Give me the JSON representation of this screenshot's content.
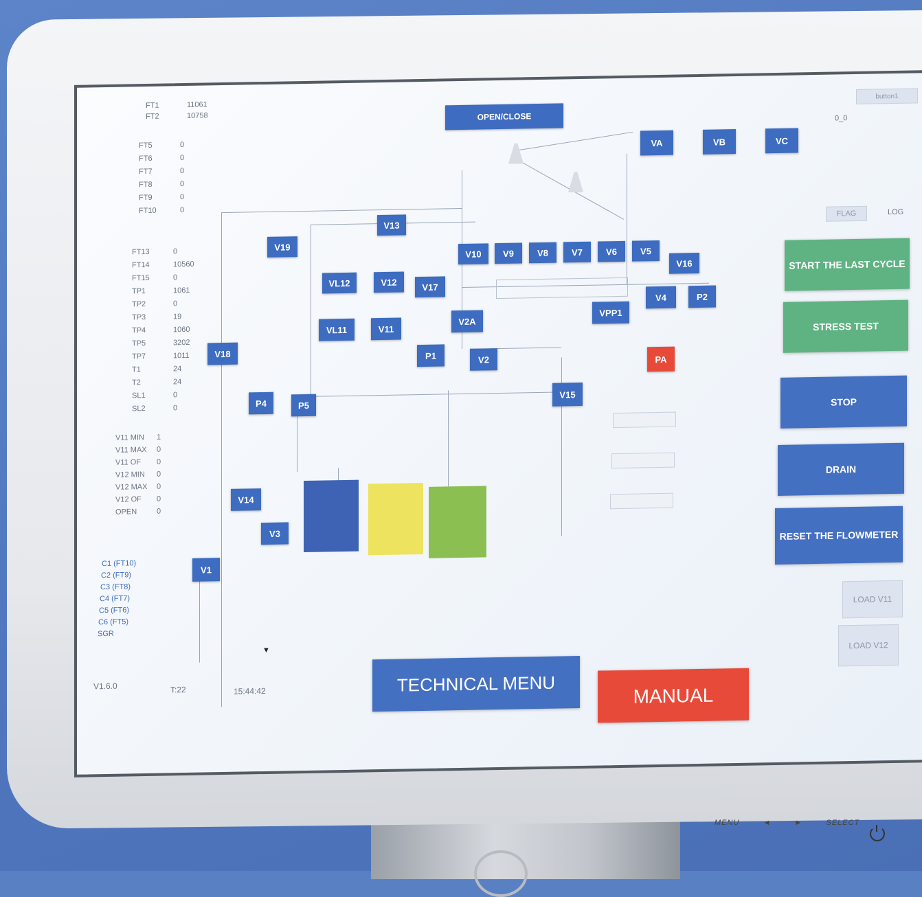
{
  "top_button": "OPEN/CLOSE",
  "top_right": "button1",
  "sensors_top": [
    [
      "FT1",
      "11061"
    ],
    [
      "FT2",
      "10758"
    ]
  ],
  "sensors_mid": [
    [
      "FT5",
      "0"
    ],
    [
      "FT6",
      "0"
    ],
    [
      "FT7",
      "0"
    ],
    [
      "FT8",
      "0"
    ],
    [
      "FT9",
      "0"
    ],
    [
      "FT10",
      "0"
    ]
  ],
  "sensors_list": [
    [
      "FT13",
      "0"
    ],
    [
      "FT14",
      "10560"
    ],
    [
      "FT15",
      "0"
    ],
    [
      "TP1",
      "1061"
    ],
    [
      "TP2",
      "0"
    ],
    [
      "TP3",
      "19"
    ],
    [
      "TP4",
      "1060"
    ],
    [
      "TP5",
      "3202"
    ],
    [
      "TP7",
      "1011"
    ],
    [
      "T1",
      "24"
    ],
    [
      "T2",
      "24"
    ],
    [
      "SL1",
      "0"
    ],
    [
      "SL2",
      "0"
    ]
  ],
  "limits": [
    [
      "V11 MIN",
      "1"
    ],
    [
      "V11 MAX",
      "0"
    ],
    [
      "V11 OF",
      "0"
    ],
    [
      "V12 MIN",
      "0"
    ],
    [
      "V12 MAX",
      "0"
    ],
    [
      "V12 OF",
      "0"
    ],
    [
      "OPEN",
      "0"
    ]
  ],
  "counters": [
    "C1 (FT10)",
    "C2 (FT9)",
    "C3 (FT8)",
    "C4 (FT7)",
    "C5 (FT6)",
    "C6 (FT5)",
    "SGR"
  ],
  "status": {
    "version": "V1.6.0",
    "temp": "T:22",
    "time": "15:44:42"
  },
  "right_labels": {
    "r1": "0_0",
    "flag": "FLAG",
    "log": "LOG"
  },
  "valves": {
    "VA": "VA",
    "VB": "VB",
    "VC": "VC",
    "V13": "V13",
    "V19": "V19",
    "V10": "V10",
    "V9": "V9",
    "V8": "V8",
    "V7": "V7",
    "V6": "V6",
    "V5": "V5",
    "V16": "V16",
    "VL12": "VL12",
    "V12": "V12",
    "V17": "V17",
    "V4": "V4",
    "P2": "P2",
    "VL11": "VL11",
    "V11": "V11",
    "V2A": "V2A",
    "VPP1": "VPP1",
    "V18": "V18",
    "P1": "P1",
    "V2": "V2",
    "PA": "PA",
    "V15": "V15",
    "P4": "P4",
    "P5": "P5",
    "V14": "V14",
    "V3": "V3",
    "V1": "V1"
  },
  "actions": {
    "start_last_cycle": "START THE LAST CYCLE",
    "stress_test": "STRESS TEST",
    "stop": "STOP",
    "drain": "DRAIN",
    "reset_flowmeter": "RESET THE FLOWMETER",
    "load_v11": "LOAD V11",
    "load_v12": "LOAD V12"
  },
  "bottom": {
    "technical_menu": "TECHNICAL MENU",
    "manual": "MANUAL"
  },
  "monitor_controls": [
    "MENU",
    "◄",
    "►",
    "SELECT"
  ],
  "colors": {
    "valve": "#3d6cc0",
    "alarm": "#e84a3a",
    "action_green": "#5fb382",
    "tank_blue": "#3e62b4",
    "tank_yellow": "#ede35e",
    "tank_green": "#8cbf52"
  }
}
